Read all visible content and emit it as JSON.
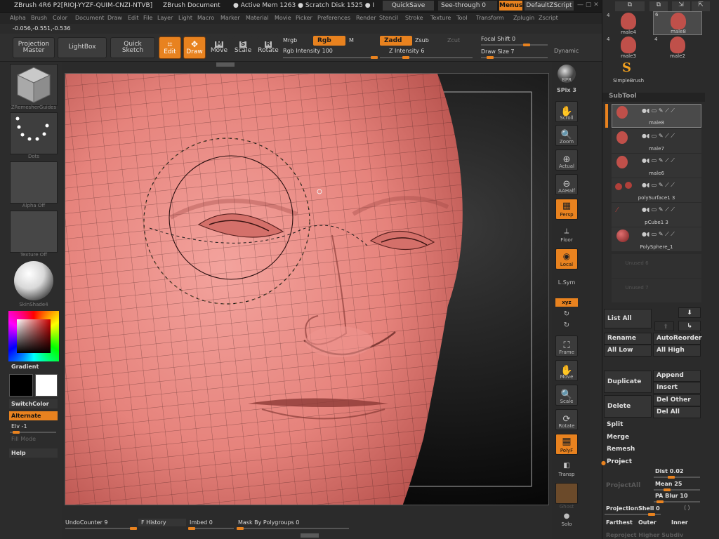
{
  "topbar": {
    "app": "ZBrush 4R6 P2[RIOJ-YYZF-QUIM-CNZI-NTVB]",
    "doc": "ZBrush Document",
    "mem": "● Active Mem 1263 ● Scratch Disk 1525 ● I",
    "quicksave": "QuickSave",
    "seethrough": "See-through  0",
    "menus": "Menus",
    "defaultscript": "DefaultZScript"
  },
  "menus": [
    "Alpha",
    "Brush",
    "Color",
    "Document",
    "Draw",
    "Edit",
    "File",
    "Layer",
    "Light",
    "Macro",
    "Marker",
    "Material",
    "Movie",
    "Picker",
    "Preferences",
    "Render",
    "Stencil",
    "Stroke",
    "Texture",
    "Tool",
    "Transform",
    "Zplugin",
    "Zscript"
  ],
  "coords": "-0.056,-0.551,-0.536",
  "toolbar": {
    "projection_master": "Projection\nMaster",
    "lightbox": "LightBox",
    "quick_sketch": "Quick\nSketch",
    "edit": "Edit",
    "draw": "Draw",
    "move": "Move",
    "scale": "Scale",
    "rotate": "Rotate",
    "mrgb": "Mrgb",
    "rgb": "Rgb",
    "m": "M",
    "rgb_intensity": "Rgb  Intensity 100",
    "zadd": "Zadd",
    "zsub": "Zsub",
    "zcut": "Zcut",
    "z_intensity": "Z  Intensity 6",
    "focal_shift": "Focal Shift 0",
    "draw_size": "Draw Size 7",
    "dynamic": "Dynamic"
  },
  "left": {
    "brush_lbl": "ZRemesherGuides",
    "stroke_lbl": "Dots",
    "alpha_lbl": "Alpha Off",
    "texture_lbl": "Texture Off",
    "material_lbl": "SkinShade4",
    "gradient": "Gradient",
    "switchcolor": "SwitchColor",
    "alternate": "Alternate",
    "elv": "Elv -1",
    "fill_mode": "Fill Mode",
    "help": "Help"
  },
  "shelf": [
    "BPR",
    "SPix 3",
    "Scroll",
    "Zoom",
    "Actual",
    "AAHalf",
    "Persp",
    "Floor",
    "Local",
    "L.Sym",
    "xyz",
    "Frame",
    "Move",
    "Scale",
    "Rotate",
    "PolyF",
    "Transp",
    "Ghost",
    "Solo"
  ],
  "tool_palette": [
    {
      "n": "4",
      "name": "male4"
    },
    {
      "n": "6",
      "name": "male8"
    },
    {
      "n": "4",
      "name": "male3"
    },
    {
      "n": "4",
      "name": "male2"
    },
    {
      "n": "",
      "name": "SimpleBrush"
    }
  ],
  "subtool": {
    "title": "SubTool",
    "items": [
      "male8",
      "male7",
      "male6",
      "polySurface1 3",
      "pCube1 3",
      "PolySphere_1",
      "Unused 6",
      "Unused 7"
    ]
  },
  "subtool_buttons": {
    "list_all": "List All",
    "rename": "Rename",
    "autoreorder": "AutoReorder",
    "all_low": "All Low",
    "all_high": "All High",
    "duplicate": "Duplicate",
    "append": "Append",
    "insert": "Insert",
    "delete": "Delete",
    "del_other": "Del Other",
    "del_all": "Del All",
    "split": "Split",
    "merge": "Merge",
    "remesh": "Remesh",
    "project": "Project",
    "projectall": "ProjectAll",
    "dist": "Dist 0.02",
    "mean": "Mean 25",
    "pa_blur": "PA  Blur 10",
    "projectionshell": "ProjectionShell 0",
    "farthest": "Farthest",
    "outer": "Outer",
    "inner": "Inner",
    "reproject": "Reproject Higher Subdiv"
  },
  "bottom": {
    "undo": "UndoCounter 9",
    "history": "F History",
    "imbed": "Imbed 0",
    "mask_polygroups": "Mask By Polygroups 0"
  },
  "colors": {
    "accent": "#e8821f",
    "skin": "#e88580"
  }
}
